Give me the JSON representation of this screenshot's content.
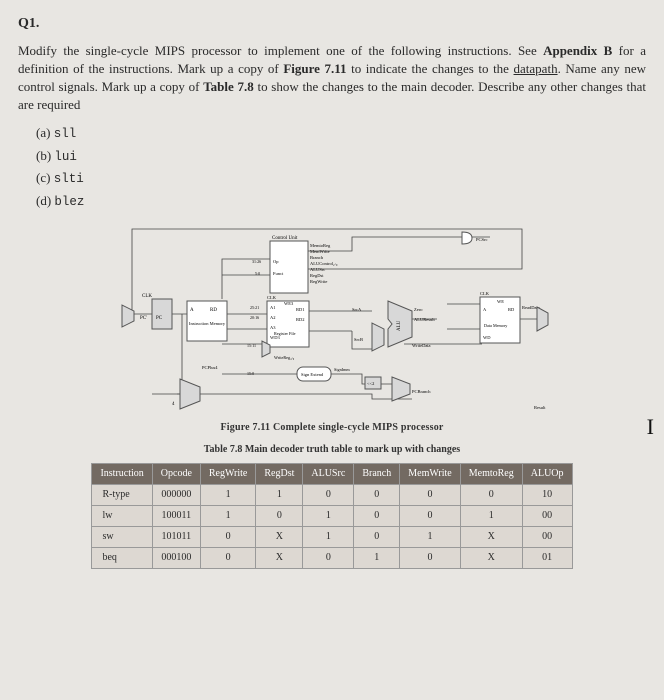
{
  "question": {
    "title": "Q1.",
    "text_before_appendix": "Modify the single-cycle MIPS processor to implement one of the following instructions. See ",
    "appendix": "Appendix B",
    "text_after_appendix": " for a definition of the instructions. Mark up a copy of ",
    "figref": "Figure 7.11",
    "text_after_fig": " to indicate the changes to the ",
    "datapath": "datapath",
    "text_after_dp": ". Name any new control signals. Mark up a copy of ",
    "tableref": "Table 7.8",
    "text_after_tab": " to show the changes to the main decoder. Describe any other changes that are required",
    "options": [
      {
        "label": "(a)",
        "code": "sll"
      },
      {
        "label": "(b)",
        "code": "lui"
      },
      {
        "label": "(c)",
        "code": "slti"
      },
      {
        "label": "(d)",
        "code": "blez"
      }
    ]
  },
  "figure": {
    "caption": "Figure 7.11 Complete single-cycle MIPS processor",
    "labels": {
      "control_unit": "Control Unit",
      "memto_reg": "MemtoReg",
      "memwrite": "MemWrite",
      "branch": "Branch",
      "alucontrol": "ALUControl₂:₀",
      "op": "Op",
      "funct": "Funct",
      "alusrc": "ALUSrc",
      "regdst": "RegDst",
      "regwrite": "RegWrite",
      "clk": "CLK",
      "pc": "PC",
      "pcprime": "PC'",
      "a": "A",
      "rd": "RD",
      "instruction_memory": "Instruction Memory",
      "instr": "Instr",
      "bits_31_26": "31:26",
      "bits_5_0": "5:0",
      "bits_25_21": "25:21",
      "bits_20_16": "20:16",
      "bits_15_11": "15:11",
      "bits_15_0": "15:0",
      "a1": "A1",
      "a2": "A2",
      "a3": "A3",
      "wd3": "WD3",
      "we3": "WE3",
      "rd1": "RD1",
      "rd2": "RD2",
      "register_file": "Register File",
      "pcplus4": "PCPlus4",
      "plus4": "4",
      "sign_extend": "Sign Extend",
      "signimm": "SignImm",
      "shift2": "<<2",
      "writereg": "WriteReg₄:₀",
      "srca": "SrcA",
      "srcb": "SrcB",
      "alu": "ALU",
      "zero": "Zero",
      "aluresult": "ALUResult",
      "writedata": "WriteData",
      "pcbranch": "PCBranch",
      "pcsrc": "PCSrc",
      "a_dm": "A",
      "rd_dm": "RD",
      "we": "WE",
      "wd": "WD",
      "data_memory": "Data Memory",
      "readdata": "ReadData",
      "result": "Result"
    }
  },
  "table": {
    "caption": "Table 7.8 Main decoder truth table to mark up with changes",
    "headers": [
      "Instruction",
      "Opcode",
      "RegWrite",
      "RegDst",
      "ALUSrc",
      "Branch",
      "MemWrite",
      "MemtoReg",
      "ALUOp"
    ],
    "rows": [
      {
        "instr": "R-type",
        "opcode": "000000",
        "regwrite": "1",
        "regdst": "1",
        "alusrc": "0",
        "branch": "0",
        "memwrite": "0",
        "memtoreg": "0",
        "aluop": "10"
      },
      {
        "instr": "lw",
        "opcode": "100011",
        "regwrite": "1",
        "regdst": "0",
        "alusrc": "1",
        "branch": "0",
        "memwrite": "0",
        "memtoreg": "1",
        "aluop": "00"
      },
      {
        "instr": "sw",
        "opcode": "101011",
        "regwrite": "0",
        "regdst": "X",
        "alusrc": "1",
        "branch": "0",
        "memwrite": "1",
        "memtoreg": "X",
        "aluop": "00"
      },
      {
        "instr": "beq",
        "opcode": "000100",
        "regwrite": "0",
        "regdst": "X",
        "alusrc": "0",
        "branch": "1",
        "memwrite": "0",
        "memtoreg": "X",
        "aluop": "01"
      }
    ]
  },
  "chart_data": {
    "type": "table",
    "title": "Table 7.8 Main decoder truth table to mark up with changes",
    "columns": [
      "Instruction",
      "Opcode",
      "RegWrite",
      "RegDst",
      "ALUSrc",
      "Branch",
      "MemWrite",
      "MemtoReg",
      "ALUOp"
    ],
    "rows": [
      [
        "R-type",
        "000000",
        1,
        1,
        0,
        0,
        0,
        0,
        "10"
      ],
      [
        "lw",
        "100011",
        1,
        0,
        1,
        0,
        0,
        1,
        "00"
      ],
      [
        "sw",
        "101011",
        0,
        "X",
        1,
        0,
        1,
        "X",
        "00"
      ],
      [
        "beq",
        "000100",
        0,
        "X",
        0,
        1,
        0,
        "X",
        "01"
      ]
    ]
  }
}
